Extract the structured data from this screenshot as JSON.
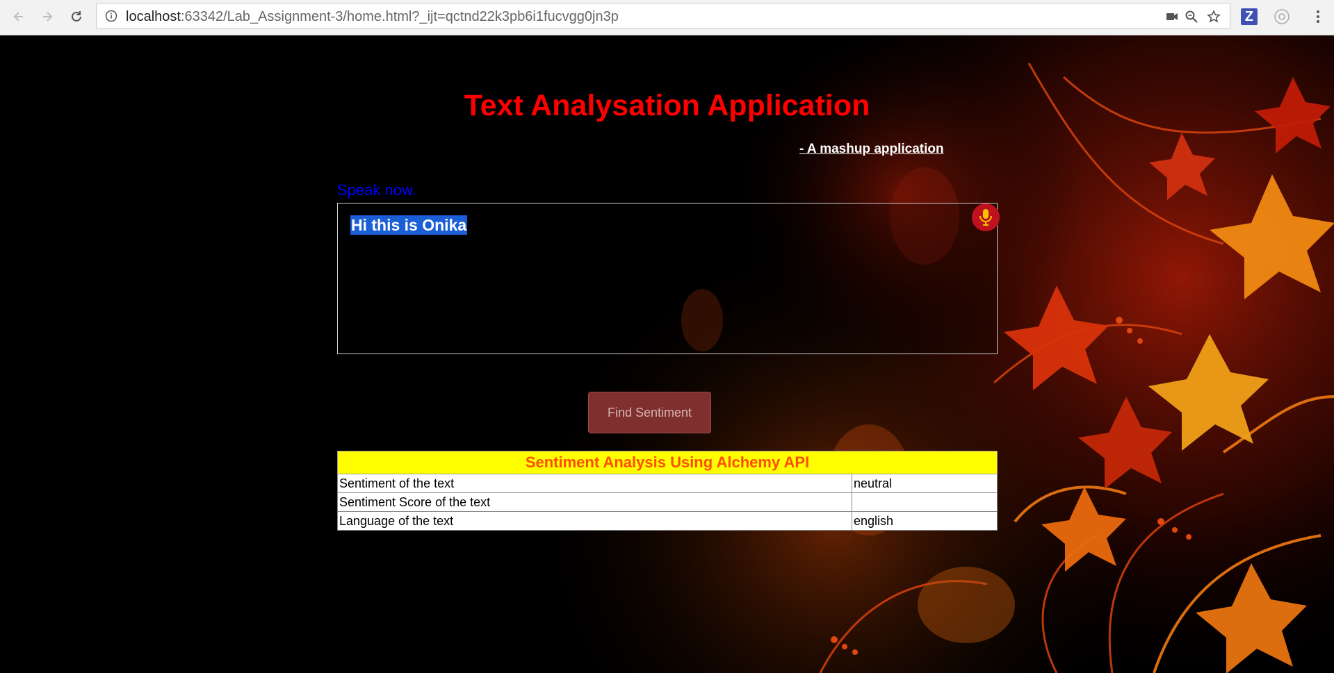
{
  "browser": {
    "url_host": "localhost",
    "url_rest": ":63342/Lab_Assignment-3/home.html?_ijt=qctnd22k3pb6i1fucvgg0jn3p",
    "extension_label": "Z"
  },
  "page": {
    "title": "Text Analysation Application",
    "subtitle": "- A mashup application",
    "speak_label": "Speak now.",
    "text_input_value": "Hi this is Onika",
    "find_button_label": "Find Sentiment",
    "table": {
      "header": "Sentiment Analysis Using Alchemy API",
      "rows": [
        {
          "label": "Sentiment of the text",
          "value": "neutral"
        },
        {
          "label": "Sentiment Score of the text",
          "value": ""
        },
        {
          "label": "Language of the text",
          "value": "english"
        }
      ]
    }
  },
  "colors": {
    "title": "#ff0000",
    "speak_label": "#0000ff",
    "table_header_bg": "#ffff00",
    "table_header_text": "#ff4d00",
    "button_bg": "#7f2f2e",
    "mic_bg": "#c0121e"
  }
}
